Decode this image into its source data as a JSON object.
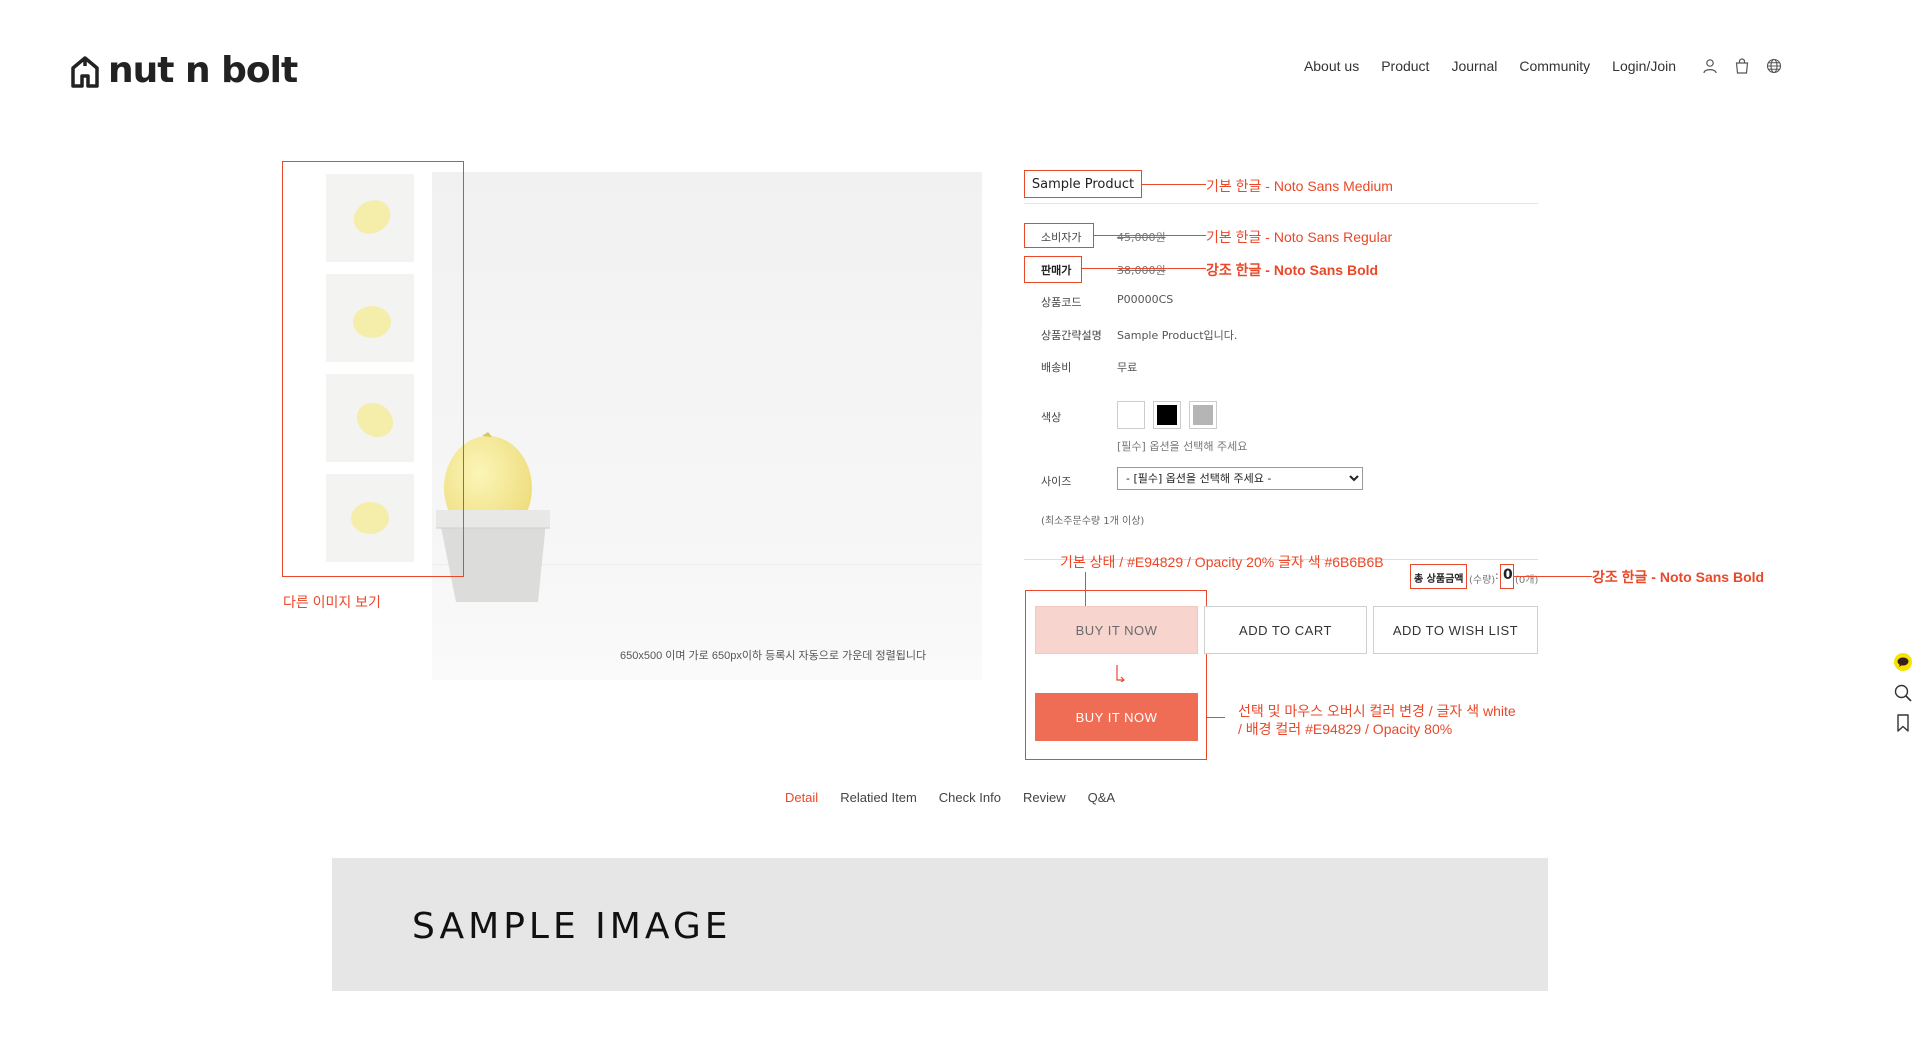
{
  "header": {
    "logo_text": "nut n bolt",
    "nav": [
      "About us",
      "Product",
      "Journal",
      "Community",
      "Login/Join"
    ],
    "icons": [
      "user-icon",
      "bag-icon",
      "globe-icon"
    ]
  },
  "gallery": {
    "thumbnails_count": 4,
    "main_caption": "650x500 이며 가로 650px이하 등록시 자동으로 가운데 정렬됩니다"
  },
  "product": {
    "name": "Sample Product",
    "rows": [
      {
        "label": "소비자가",
        "value": "45,000원"
      },
      {
        "label": "판매가",
        "value": "38,000원"
      },
      {
        "label": "상품코드",
        "value": "P00000CS"
      },
      {
        "label": "상품간략설명",
        "value": "Sample Product입니다."
      },
      {
        "label": "배송비",
        "value": "무료"
      }
    ],
    "color_label": "색상",
    "color_swatches": [
      "#ffffff",
      "#000000",
      "#b5b5b5"
    ],
    "color_hint": "[필수] 옵션을 선택해 주세요",
    "size_label": "사이즈",
    "size_selected": "- [필수] 옵션을 선택해 주세요 -",
    "min_order": "(최소주문수량 1개 이상)",
    "total": {
      "label": "총 상품금액",
      "qty_label": "(수량)",
      "sep": ":",
      "amount": "0",
      "count": "(0개)"
    }
  },
  "buttons": {
    "buy_now": "BUY IT NOW",
    "add_to_cart": "ADD TO CART",
    "add_to_wishlist": "ADD TO WISH LIST"
  },
  "annotations": {
    "thumbs": "다른 이미지 보기",
    "title_font": "기본 한글 - Noto Sans Medium",
    "regular_font": "기본 한글 - Noto Sans Regular",
    "bold_font": "강조 한글 - Noto Sans Bold",
    "button_default": "기본 상태 / #E94829 / Opacity 20% 글자 색 #6B6B6B",
    "total_font": "강조 한글 - Noto Sans Bold",
    "button_hover_line1": "선택 및 마우스 오버시 컬러 변경 / 글자 색 white",
    "button_hover_line2": "/ 배경 컬러 #E94829 / Opacity 80%",
    "accent_color": "#E94829"
  },
  "tabs": {
    "items": [
      "Detail",
      "Relatied Item",
      "Check Info",
      "Review",
      "Q&A"
    ],
    "active": "Detail"
  },
  "banner": {
    "text": "SAMPLE IMAGE"
  },
  "side": {
    "icons": [
      "chat-icon",
      "search-icon",
      "bookmark-icon"
    ]
  }
}
